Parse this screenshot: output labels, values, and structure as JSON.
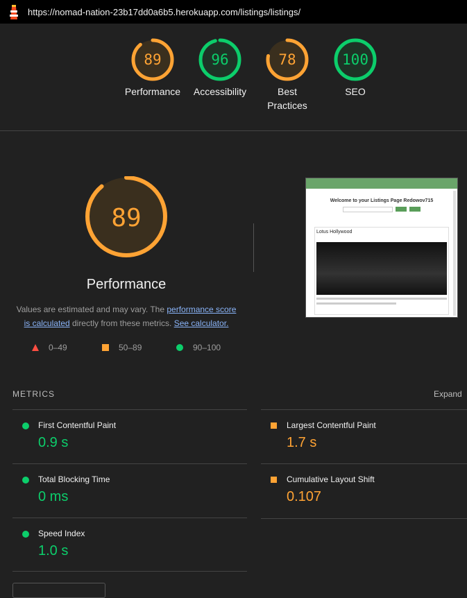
{
  "browser": {
    "url": "https://nomad-nation-23b17dd0a6b5.herokuapp.com/listings/listings/"
  },
  "gauges": [
    {
      "score": "89",
      "label": "Performance",
      "fraction": 0.89,
      "status": "average"
    },
    {
      "score": "96",
      "label": "Accessibility",
      "fraction": 0.96,
      "status": "pass"
    },
    {
      "score": "78",
      "label": "Best Practices",
      "fraction": 0.78,
      "status": "average"
    },
    {
      "score": "100",
      "label": "SEO",
      "fraction": 1.0,
      "status": "pass"
    }
  ],
  "performance": {
    "score": "89",
    "fraction": 0.89,
    "title": "Performance",
    "desc_prefix": "Values are estimated and may vary. The ",
    "desc_link1": "performance score is calculated",
    "desc_middle": " directly from these metrics. ",
    "desc_link2": "See calculator."
  },
  "legend": {
    "fail": "0–49",
    "average": "50–89",
    "pass": "90–100"
  },
  "screenshot": {
    "heading": "Welcome to your Listings Page Redowov715",
    "card_title": "Lotus Hollywood"
  },
  "metrics": {
    "header": "METRICS",
    "expand": "Expand",
    "items": [
      {
        "name": "First Contentful Paint",
        "value": "0.9 s",
        "status": "pass"
      },
      {
        "name": "Largest Contentful Paint",
        "value": "1.7 s",
        "status": "average"
      },
      {
        "name": "Total Blocking Time",
        "value": "0 ms",
        "status": "pass"
      },
      {
        "name": "Cumulative Layout Shift",
        "value": "0.107",
        "status": "average"
      },
      {
        "name": "Speed Index",
        "value": "1.0 s",
        "status": "pass"
      }
    ]
  },
  "colors": {
    "pass": "#0cce6b",
    "average": "#ffa334",
    "fail": "#ff4e42"
  }
}
